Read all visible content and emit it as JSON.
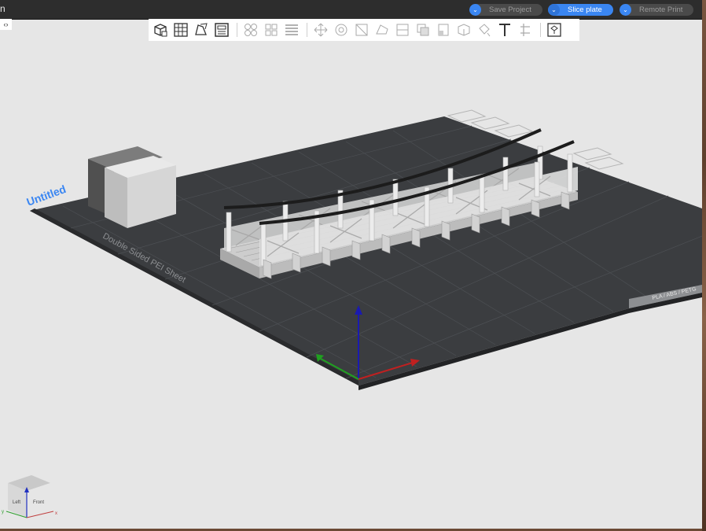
{
  "window": {
    "title": "n"
  },
  "actions": {
    "save_project": "Save Project",
    "slice_plate": "Slice plate",
    "remote_print": "Remote Print"
  },
  "toolbar": {
    "groups": [
      [
        "add-object-icon",
        "arrange-grid-icon",
        "auto-orient-icon",
        "layer-view-icon"
      ],
      [
        "split-objects-icon",
        "split-parts-icon",
        "variable-layer-icon"
      ],
      [
        "move-icon",
        "rotate-icon",
        "scale-icon",
        "lay-on-face-icon",
        "cut-icon",
        "boolean-icon",
        "support-paint-icon",
        "seam-paint-icon",
        "color-paint-icon",
        "text-icon",
        "measure-icon"
      ],
      [
        "assembly-icon"
      ]
    ]
  },
  "plate": {
    "name": "Untitled",
    "sheet_label": "Double Sided PEI Sheet",
    "filament_tag": "PLA / ABS / PETG"
  },
  "view_cube": {
    "left": "Left",
    "front": "Front",
    "axis_y": "y",
    "axis_x": "x"
  },
  "colors": {
    "accent": "#3a86f2",
    "bed": "#3b3d40",
    "model": "#cfcfcf",
    "cable": "#1c1c1c",
    "axis_x": "#c02020",
    "axis_y": "#20a020",
    "axis_z": "#1a1ab0"
  }
}
